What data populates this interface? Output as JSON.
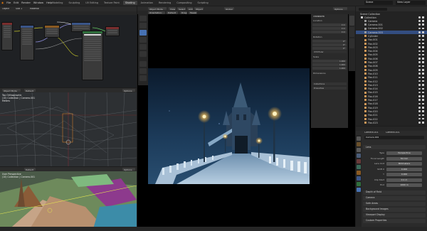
{
  "topbar": {
    "menus": [
      "File",
      "Edit",
      "Render",
      "Window",
      "Help"
    ],
    "workspaces": [
      "Modeling",
      "Sculpting",
      "UV Editing",
      "Texture Paint",
      "Shading",
      "Animation",
      "Rendering",
      "Compositing",
      "Scripting"
    ],
    "active_workspace": "Shading",
    "scene": "Scene",
    "view_layer": "View Layer"
  },
  "node_editor": {
    "object_label": "Object",
    "slot": "Slot 1",
    "material": "Material"
  },
  "wire_viewport_1": {
    "mode": "Object Mode",
    "view": "Default",
    "overlay_lines": [
      "Top Orthographic",
      "(10) Collection | Camera.001",
      "Meters"
    ],
    "options": "Options"
  },
  "wire_viewport_2": {
    "view": "Default",
    "overlay_lines": [
      "User Perspective",
      "(10) Collection | Camera.001"
    ],
    "options": "Options"
  },
  "camera_view": {
    "mode": "Object Mode",
    "view_btns": [
      "View",
      "Select",
      "Add",
      "Object"
    ],
    "global": "Global",
    "chips": [
      "Orientation:",
      "Default",
      "Drag:",
      "Tweak"
    ],
    "options": "Options"
  },
  "n_panel": {
    "tabs": [
      "Item",
      "Tool",
      "View"
    ],
    "sections": [
      "Transform",
      "Location",
      "Rotation",
      "Scale",
      "Dimensions",
      "Collections",
      "Properties"
    ],
    "fields": [
      "0 m",
      "0 m",
      "0 m",
      "0°",
      "0°",
      "0°",
      "1.000",
      "1.000",
      "1.000"
    ],
    "mode": "XYZ Euler"
  },
  "outliner": {
    "title": "Scene Collection",
    "collection": "Collection",
    "items": [
      "Camera",
      "Camera.001",
      "Camera.002",
      "Camera.003",
      "Cylinder",
      "Fbx.001",
      "Fbx.002",
      "Fbx.003",
      "Fbx.004",
      "Fbx.005",
      "Fbx.006",
      "Fbx.007",
      "Fbx.008",
      "Fbx.009",
      "Fbx.010",
      "Fbx.011",
      "Fbx.012",
      "Fbx.013",
      "Fbx.014",
      "Fbx.015",
      "Fbx.016",
      "Fbx.017",
      "Fbx.018",
      "Fbx.019",
      "Fbx.020",
      "Fbx.021",
      "Fbx.022",
      "Fbx.023"
    ],
    "selected_index": 3
  },
  "properties": {
    "breadcrumb": [
      "Camera.001",
      "Camera.001"
    ],
    "name": "Camera.001",
    "lens_section": "Lens",
    "rows": [
      {
        "label": "Type",
        "value": "Perspective"
      },
      {
        "label": "Focal Length",
        "value": "50 mm"
      },
      {
        "label": "Lens Unit",
        "value": "Millimeters"
      },
      {
        "label": "Shift X",
        "value": "0.000"
      },
      {
        "label": "Y",
        "value": "0.000"
      },
      {
        "label": "Clip Start",
        "value": "0.1 m"
      },
      {
        "label": "End",
        "value": "1000 m"
      }
    ],
    "sections": [
      "Depth of Field",
      "Camera",
      "Safe Areas",
      "Background Images",
      "Viewport Display",
      "Custom Properties"
    ]
  },
  "colors": {
    "accent": "#4772b3",
    "selected_row": "#334d80",
    "node_header_green": "#2f6f3c",
    "node_header_red": "#7a2e2e",
    "node_header_blue": "#3a5588",
    "node_header_orange": "#8a5a22"
  }
}
